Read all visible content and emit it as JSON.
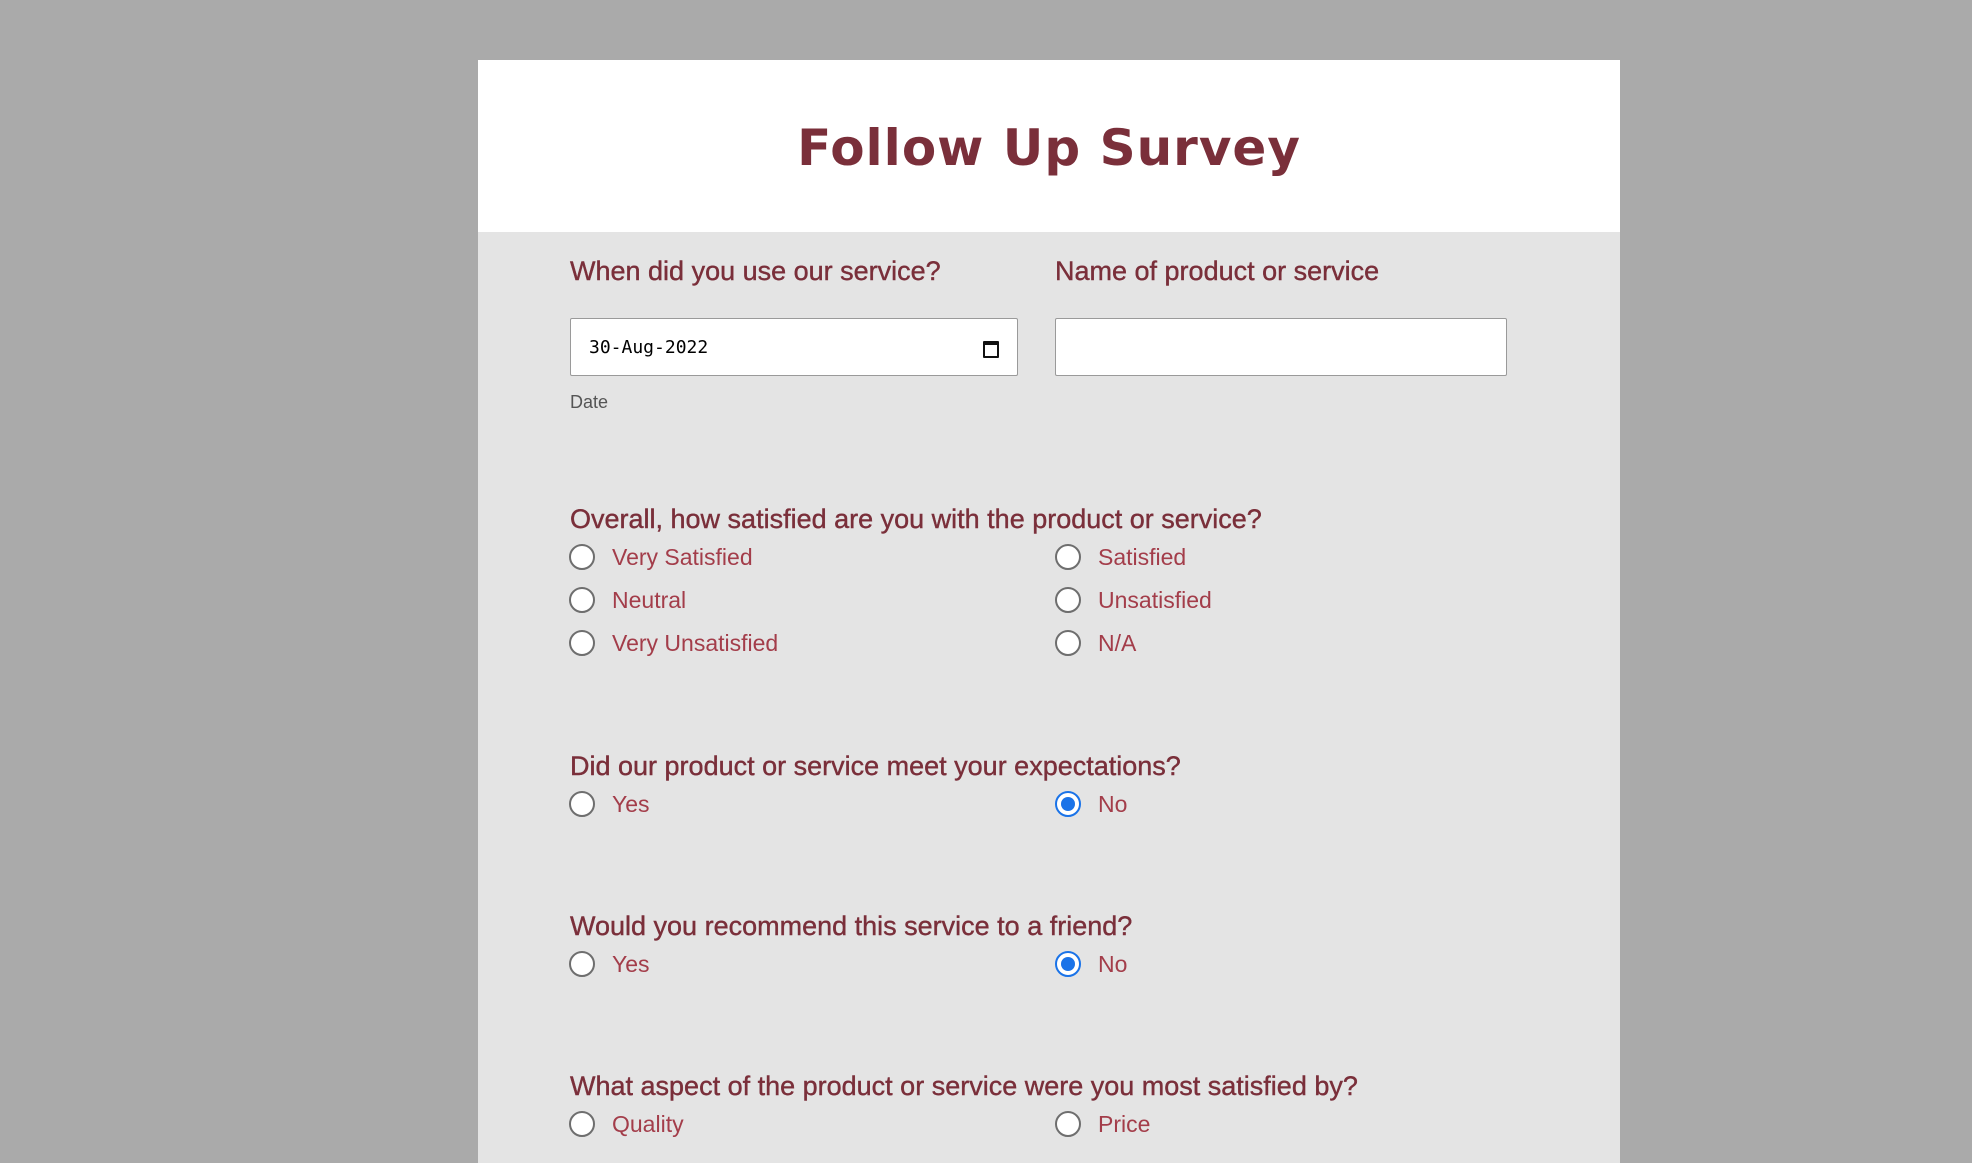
{
  "survey": {
    "title": "Follow Up Survey"
  },
  "service_date": {
    "label": "When did you use our service?",
    "value": "30-Aug-2022",
    "hint": "Date"
  },
  "product_name": {
    "label": "Name of product or service",
    "value": ""
  },
  "satisfaction": {
    "question": "Overall, how satisfied are you with the product or service?",
    "options": [
      "Very Satisfied",
      "Satisfied",
      "Neutral",
      "Unsatisfied",
      "Very Unsatisfied",
      "N/A"
    ],
    "selected": null
  },
  "expectations": {
    "question": "Did our product or service meet your expectations?",
    "options": [
      "Yes",
      "No"
    ],
    "selected": "No"
  },
  "recommend": {
    "question": "Would you recommend this service to a friend?",
    "options": [
      "Yes",
      "No"
    ],
    "selected": "No"
  },
  "aspect": {
    "question": "What aspect of the product or service were you most satisfied by?",
    "options": [
      "Quality",
      "Price"
    ],
    "selected": null
  },
  "colors": {
    "heading": "#7a2f3a",
    "option_text": "#a33d4a",
    "radio_selected": "#1a73e8",
    "page_bg": "#aaaaaa",
    "form_bg": "#e4e4e4"
  },
  "icons": {
    "date_picker": "calendar-icon"
  }
}
